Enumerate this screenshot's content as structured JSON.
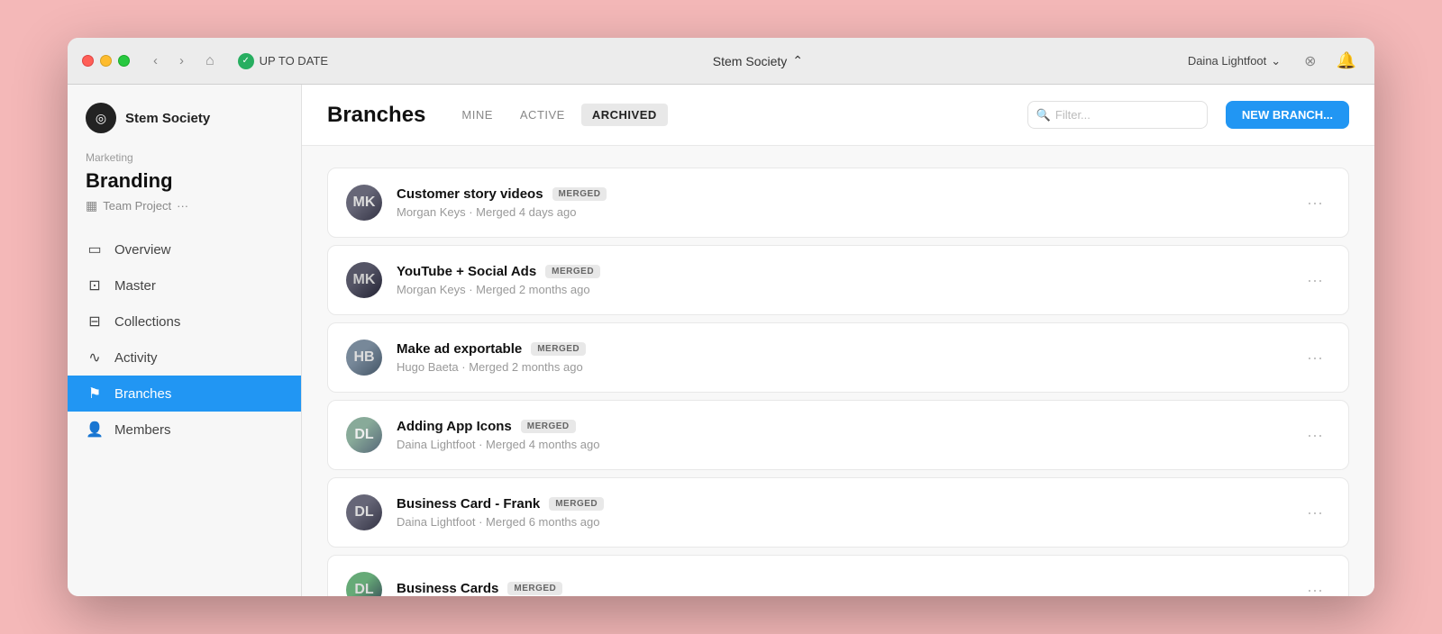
{
  "window": {
    "title": "Stem Society"
  },
  "titlebar": {
    "status": "UP TO DATE",
    "workspace": "Stem Society",
    "user": "Daina Lightfoot",
    "back_label": "‹",
    "forward_label": "›",
    "home_label": "⌂"
  },
  "sidebar": {
    "logo_text": "Stem Society",
    "section_label": "Marketing",
    "project_name": "Branding",
    "project_meta": "Team Project",
    "nav_items": [
      {
        "id": "overview",
        "label": "Overview",
        "icon": "📋",
        "active": false
      },
      {
        "id": "master",
        "label": "Master",
        "icon": "👑",
        "active": false
      },
      {
        "id": "collections",
        "label": "Collections",
        "icon": "📂",
        "active": false
      },
      {
        "id": "activity",
        "label": "Activity",
        "icon": "〰",
        "active": false
      },
      {
        "id": "branches",
        "label": "Branches",
        "icon": "⚑",
        "active": true
      },
      {
        "id": "members",
        "label": "Members",
        "icon": "👤",
        "active": false
      }
    ]
  },
  "content": {
    "page_title": "Branches",
    "tabs": [
      {
        "id": "mine",
        "label": "MINE",
        "active": false
      },
      {
        "id": "active",
        "label": "ACTIVE",
        "active": false
      },
      {
        "id": "archived",
        "label": "ARCHIVED",
        "active": true
      }
    ],
    "filter_placeholder": "Filter...",
    "new_branch_label": "NEW BRANCH...",
    "branches": [
      {
        "id": 1,
        "name": "Customer story videos",
        "status": "MERGED",
        "meta": "Morgan Keys · Merged 4 days ago",
        "avatar_initials": "MK"
      },
      {
        "id": 2,
        "name": "YouTube + Social Ads",
        "status": "MERGED",
        "meta": "Morgan Keys · Merged 2 months ago",
        "avatar_initials": "MK"
      },
      {
        "id": 3,
        "name": "Make ad exportable",
        "status": "MERGED",
        "meta": "Hugo Baeta · Merged 2 months ago",
        "avatar_initials": "HB"
      },
      {
        "id": 4,
        "name": "Adding App Icons",
        "status": "MERGED",
        "meta": "Daina Lightfoot · Merged 4 months ago",
        "avatar_initials": "DL"
      },
      {
        "id": 5,
        "name": "Business Card - Frank",
        "status": "MERGED",
        "meta": "Daina Lightfoot · Merged 6 months ago",
        "avatar_initials": "DL"
      },
      {
        "id": 6,
        "name": "Business Cards",
        "status": "MERGED",
        "meta": "",
        "avatar_initials": "DL"
      }
    ]
  }
}
